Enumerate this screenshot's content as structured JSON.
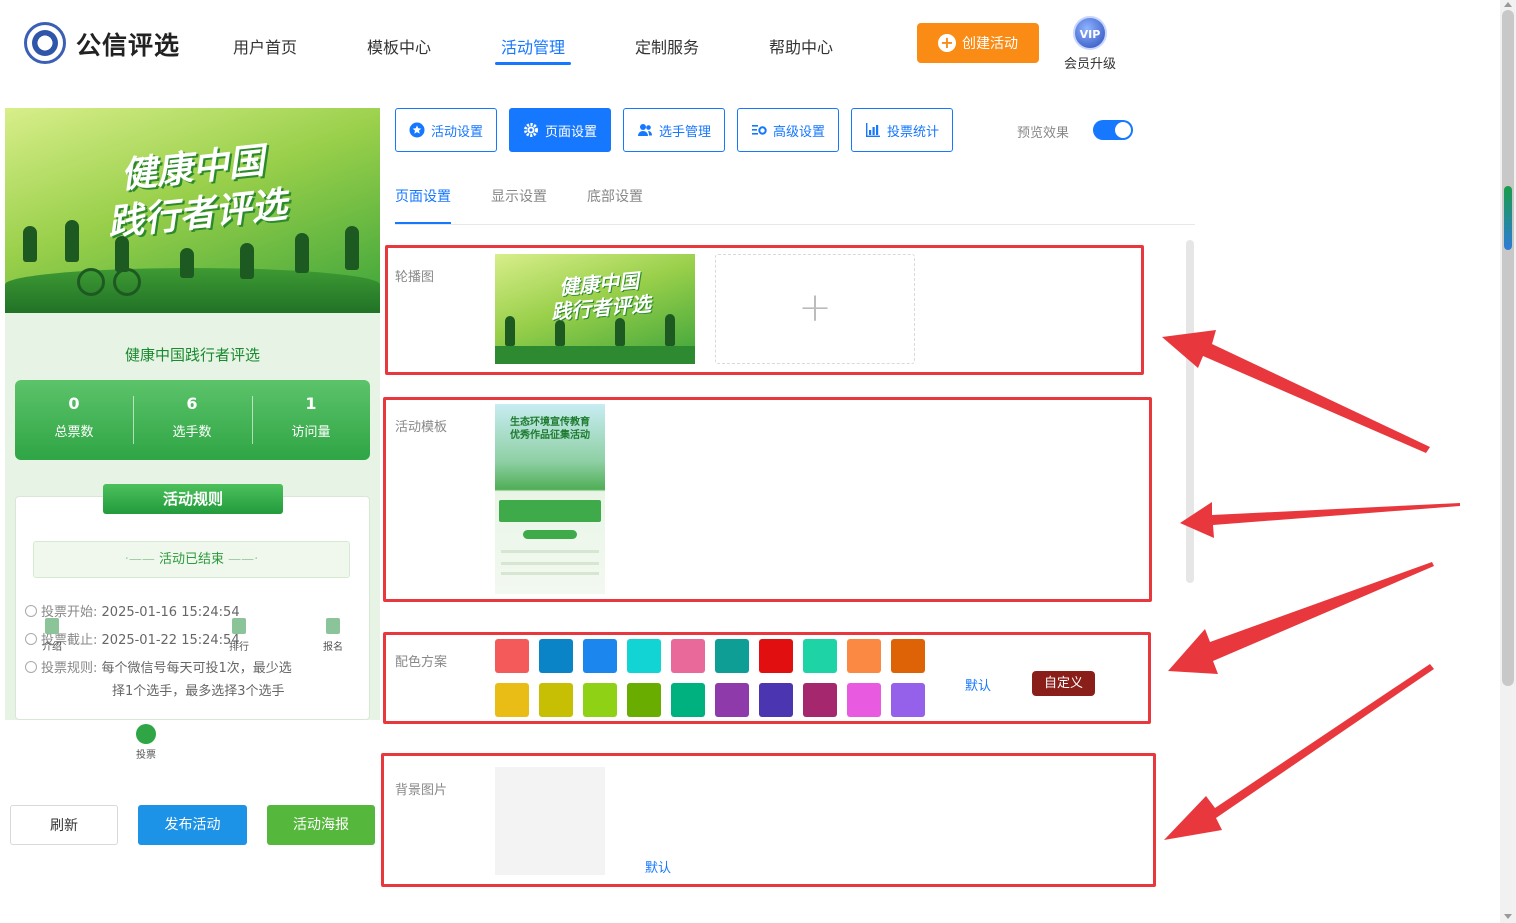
{
  "brand": {
    "name": "公信评选"
  },
  "nav": {
    "items": [
      "用户首页",
      "模板中心",
      "活动管理",
      "定制服务",
      "帮助中心"
    ],
    "active": "活动管理"
  },
  "header": {
    "create_label": "创建活动",
    "vip_badge": "VIP",
    "vip_label": "会员升级"
  },
  "preview": {
    "banner_title_line1": "健康中国",
    "banner_title_line2": "践行者评选",
    "title": "健康中国践行者评选",
    "stats": [
      {
        "value": "0",
        "label": "总票数"
      },
      {
        "value": "6",
        "label": "选手数"
      },
      {
        "value": "1",
        "label": "访问量"
      }
    ],
    "rules_title": "活动规则",
    "status": "活动已结束",
    "vote_start_label": "投票开始:",
    "vote_start": "2025-01-16 15:24:54",
    "vote_end_label": "投票截止:",
    "vote_end": "2025-01-22 15:24:54",
    "rule_label": "投票规则:",
    "rule_line1": "每个微信号每天可投1次，最少选",
    "rule_line2": "择1个选手，最多选择3个选手",
    "tabbar": [
      "介绍",
      "投票",
      "排行",
      "报名"
    ]
  },
  "actions": {
    "refresh": "刷新",
    "publish": "发布活动",
    "poster": "活动海报"
  },
  "settings": {
    "top_buttons": [
      "活动设置",
      "页面设置",
      "选手管理",
      "高级设置",
      "投票统计"
    ],
    "active_top": "页面设置",
    "preview_label": "预览效果",
    "preview_enabled": true,
    "subtabs": [
      "页面设置",
      "显示设置",
      "底部设置"
    ],
    "active_subtab": "页面设置",
    "carousel_label": "轮播图",
    "carousel_image_title_line1": "健康中国",
    "carousel_image_title_line2": "践行者评选",
    "upload_symbol": "+",
    "template_label": "活动模板",
    "template_title_line1": "生态环境宣传教育",
    "template_title_line2": "优秀作品征集活动",
    "color_label": "配色方案",
    "colors_row1": [
      "#f55a5a",
      "#0a84c7",
      "#1a86ee",
      "#12d4d4",
      "#e9699a",
      "#0e9e96",
      "#e20f10",
      "#1ed3a6",
      "#fc8943",
      "#de6307"
    ],
    "colors_row2": [
      "#e9bd15",
      "#c6bf04",
      "#8fd114",
      "#69ad00",
      "#00b180",
      "#8e3aab",
      "#4c35b0",
      "#a5276e",
      "#e85ae0",
      "#9560ea"
    ],
    "color_default": "默认",
    "color_custom": "自定义",
    "bg_label": "背景图片",
    "bg_default": "默认"
  }
}
